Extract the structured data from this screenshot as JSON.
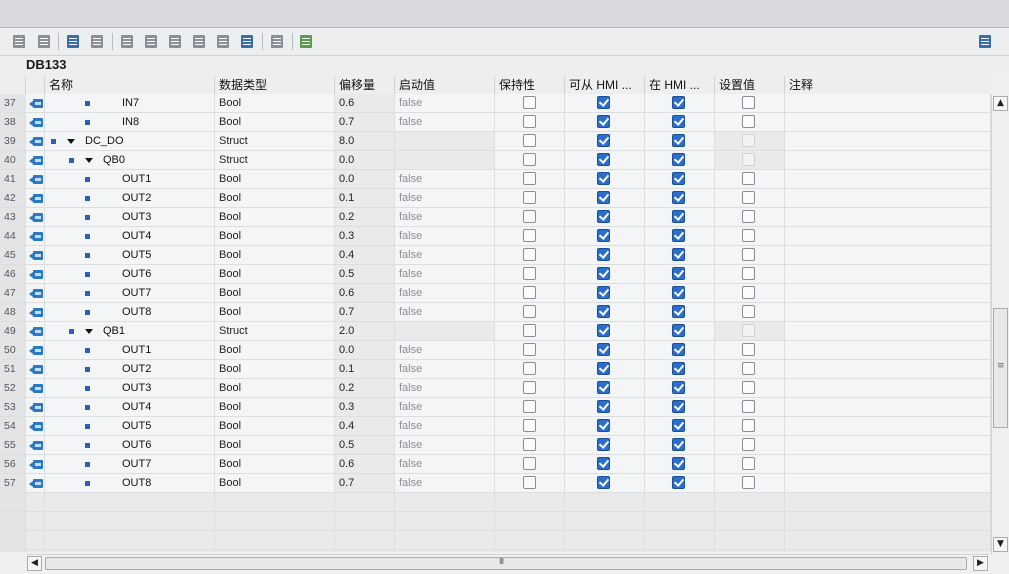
{
  "block_title": "DB133",
  "columns": {
    "name": "名称",
    "type": "数据类型",
    "offset": "偏移量",
    "start_value": "启动值",
    "retain": "保持性",
    "hmi_access": "可从 HMI ...",
    "hmi_visible": "在 HMI ...",
    "setpoint": "设置值",
    "comment": "注释"
  },
  "toolbar_icons": [
    "insert-row-icon",
    "add-row-icon",
    "db-monitor-icon",
    "snapshot-icon",
    "copy-snapshot-icon",
    "load-start-icon",
    "expand-icon",
    "collapse-icon",
    "go-icon",
    "go-step-icon",
    "list-icon",
    "keep-values-icon",
    "monitor-glasses-icon",
    "window-layout-icon"
  ],
  "rows": [
    {
      "num": "37",
      "level": 2,
      "expand": false,
      "name": "IN7",
      "type": "Bool",
      "offset": "0.6",
      "start": "false",
      "retain": false,
      "hmi1": true,
      "hmi2": true,
      "set": false,
      "set_grey": false,
      "start_grey": false
    },
    {
      "num": "38",
      "level": 2,
      "expand": false,
      "name": "IN8",
      "type": "Bool",
      "offset": "0.7",
      "start": "false",
      "retain": false,
      "hmi1": true,
      "hmi2": true,
      "set": false,
      "set_grey": false,
      "start_grey": false
    },
    {
      "num": "39",
      "level": 0,
      "expand": true,
      "name": "DC_DO",
      "type": "Struct",
      "offset": "8.0",
      "start": "",
      "retain": false,
      "hmi1": true,
      "hmi2": true,
      "set": false,
      "set_grey": true,
      "start_grey": true
    },
    {
      "num": "40",
      "level": 1,
      "expand": true,
      "name": "QB0",
      "type": "Struct",
      "offset": "0.0",
      "start": "",
      "retain": false,
      "hmi1": true,
      "hmi2": true,
      "set": false,
      "set_grey": true,
      "start_grey": true
    },
    {
      "num": "41",
      "level": 2,
      "expand": false,
      "name": "OUT1",
      "type": "Bool",
      "offset": "0.0",
      "start": "false",
      "retain": false,
      "hmi1": true,
      "hmi2": true,
      "set": false,
      "set_grey": false,
      "start_grey": false
    },
    {
      "num": "42",
      "level": 2,
      "expand": false,
      "name": "OUT2",
      "type": "Bool",
      "offset": "0.1",
      "start": "false",
      "retain": false,
      "hmi1": true,
      "hmi2": true,
      "set": false,
      "set_grey": false,
      "start_grey": false
    },
    {
      "num": "43",
      "level": 2,
      "expand": false,
      "name": "OUT3",
      "type": "Bool",
      "offset": "0.2",
      "start": "false",
      "retain": false,
      "hmi1": true,
      "hmi2": true,
      "set": false,
      "set_grey": false,
      "start_grey": false
    },
    {
      "num": "44",
      "level": 2,
      "expand": false,
      "name": "OUT4",
      "type": "Bool",
      "offset": "0.3",
      "start": "false",
      "retain": false,
      "hmi1": true,
      "hmi2": true,
      "set": false,
      "set_grey": false,
      "start_grey": false
    },
    {
      "num": "45",
      "level": 2,
      "expand": false,
      "name": "OUT5",
      "type": "Bool",
      "offset": "0.4",
      "start": "false",
      "retain": false,
      "hmi1": true,
      "hmi2": true,
      "set": false,
      "set_grey": false,
      "start_grey": false
    },
    {
      "num": "46",
      "level": 2,
      "expand": false,
      "name": "OUT6",
      "type": "Bool",
      "offset": "0.5",
      "start": "false",
      "retain": false,
      "hmi1": true,
      "hmi2": true,
      "set": false,
      "set_grey": false,
      "start_grey": false
    },
    {
      "num": "47",
      "level": 2,
      "expand": false,
      "name": "OUT7",
      "type": "Bool",
      "offset": "0.6",
      "start": "false",
      "retain": false,
      "hmi1": true,
      "hmi2": true,
      "set": false,
      "set_grey": false,
      "start_grey": false
    },
    {
      "num": "48",
      "level": 2,
      "expand": false,
      "name": "OUT8",
      "type": "Bool",
      "offset": "0.7",
      "start": "false",
      "retain": false,
      "hmi1": true,
      "hmi2": true,
      "set": false,
      "set_grey": false,
      "start_grey": false
    },
    {
      "num": "49",
      "level": 1,
      "expand": true,
      "name": "QB1",
      "type": "Struct",
      "offset": "2.0",
      "start": "",
      "retain": false,
      "hmi1": true,
      "hmi2": true,
      "set": false,
      "set_grey": true,
      "start_grey": true
    },
    {
      "num": "50",
      "level": 2,
      "expand": false,
      "name": "OUT1",
      "type": "Bool",
      "offset": "0.0",
      "start": "false",
      "retain": false,
      "hmi1": true,
      "hmi2": true,
      "set": false,
      "set_grey": false,
      "start_grey": false
    },
    {
      "num": "51",
      "level": 2,
      "expand": false,
      "name": "OUT2",
      "type": "Bool",
      "offset": "0.1",
      "start": "false",
      "retain": false,
      "hmi1": true,
      "hmi2": true,
      "set": false,
      "set_grey": false,
      "start_grey": false
    },
    {
      "num": "52",
      "level": 2,
      "expand": false,
      "name": "OUT3",
      "type": "Bool",
      "offset": "0.2",
      "start": "false",
      "retain": false,
      "hmi1": true,
      "hmi2": true,
      "set": false,
      "set_grey": false,
      "start_grey": false
    },
    {
      "num": "53",
      "level": 2,
      "expand": false,
      "name": "OUT4",
      "type": "Bool",
      "offset": "0.3",
      "start": "false",
      "retain": false,
      "hmi1": true,
      "hmi2": true,
      "set": false,
      "set_grey": false,
      "start_grey": false
    },
    {
      "num": "54",
      "level": 2,
      "expand": false,
      "name": "OUT5",
      "type": "Bool",
      "offset": "0.4",
      "start": "false",
      "retain": false,
      "hmi1": true,
      "hmi2": true,
      "set": false,
      "set_grey": false,
      "start_grey": false
    },
    {
      "num": "55",
      "level": 2,
      "expand": false,
      "name": "OUT6",
      "type": "Bool",
      "offset": "0.5",
      "start": "false",
      "retain": false,
      "hmi1": true,
      "hmi2": true,
      "set": false,
      "set_grey": false,
      "start_grey": false
    },
    {
      "num": "56",
      "level": 2,
      "expand": false,
      "name": "OUT7",
      "type": "Bool",
      "offset": "0.6",
      "start": "false",
      "retain": false,
      "hmi1": true,
      "hmi2": true,
      "set": false,
      "set_grey": false,
      "start_grey": false
    },
    {
      "num": "57",
      "level": 2,
      "expand": false,
      "name": "OUT8",
      "type": "Bool",
      "offset": "0.7",
      "start": "false",
      "retain": false,
      "hmi1": true,
      "hmi2": true,
      "set": false,
      "set_grey": false,
      "start_grey": false
    }
  ],
  "colors": {
    "checkbox_checked": "#2a6fcc",
    "tag_icon": "#2b78c5",
    "bullet": "#2b5fb6"
  }
}
